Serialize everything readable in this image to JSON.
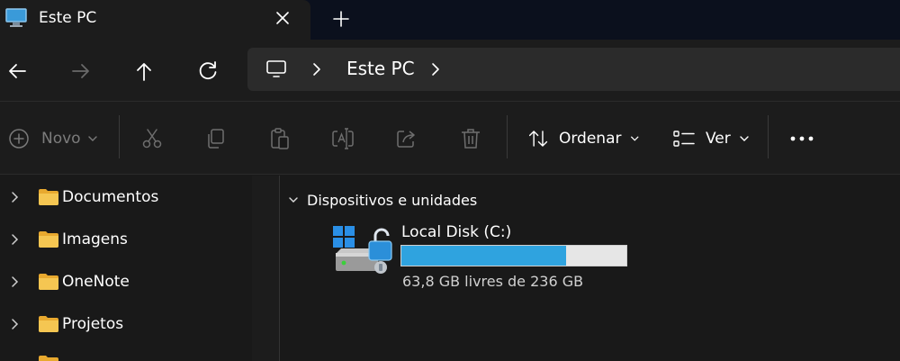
{
  "window": {
    "tab_title": "Este PC",
    "icons": [
      "monitor-icon",
      "close-icon",
      "plus-icon"
    ]
  },
  "nav": {
    "icons": [
      "arrow-left-icon",
      "arrow-right-icon",
      "arrow-up-icon",
      "refresh-icon"
    ],
    "breadcrumb": {
      "icons": [
        "monitor-icon",
        "chevron-right-icon"
      ],
      "items": [
        "Este PC"
      ]
    }
  },
  "commands": {
    "new_label": "Novo",
    "sort_label": "Ordenar",
    "view_label": "Ver",
    "icons": [
      "plus-circle-icon",
      "cut-icon",
      "copy-icon",
      "paste-icon",
      "rename-icon",
      "share-icon",
      "delete-icon",
      "sort-icon",
      "view-icon",
      "more-icon"
    ]
  },
  "sidebar": {
    "items": [
      {
        "label": "Documentos",
        "icon": "folder-icon"
      },
      {
        "label": "Imagens",
        "icon": "folder-icon"
      },
      {
        "label": "OneNote",
        "icon": "folder-icon"
      },
      {
        "label": "Projetos",
        "icon": "folder-icon"
      }
    ]
  },
  "content": {
    "group_label": "Dispositivos e unidades",
    "drives": [
      {
        "name": "Local Disk (C:)",
        "free_text": "63,8 GB livres de 236 GB",
        "used_fraction": 0.73,
        "icon": "bitlocker-unlocked-drive-icon"
      }
    ]
  },
  "colors": {
    "accent": "#2fa3df",
    "background": "#191919",
    "folder": "#f5c652"
  }
}
